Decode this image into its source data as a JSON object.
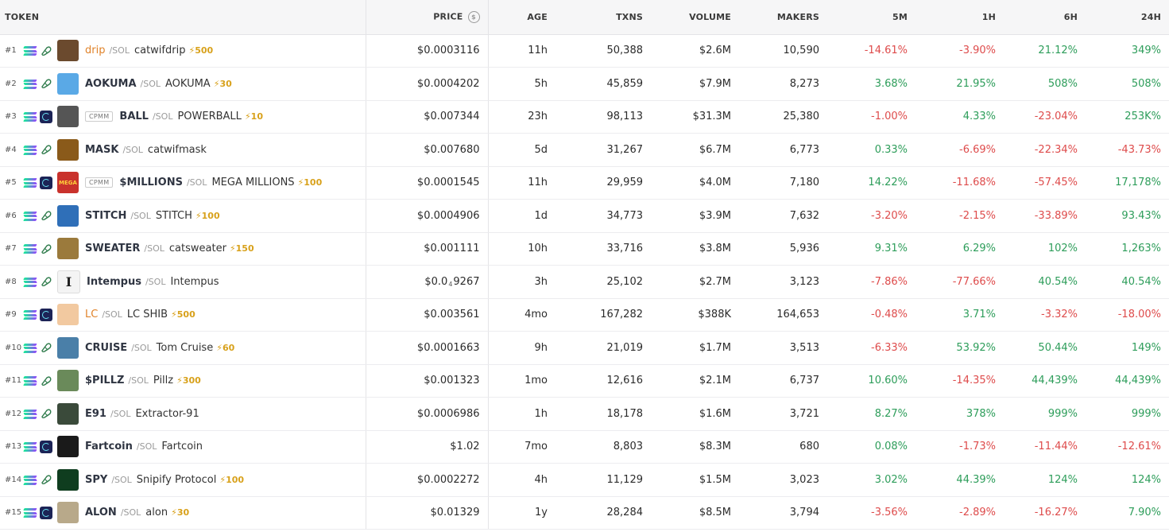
{
  "headers": {
    "token": "TOKEN",
    "price": "PRICE",
    "age": "AGE",
    "txns": "TXNS",
    "volume": "VOLUME",
    "makers": "MAKERS",
    "m5": "5M",
    "h1": "1H",
    "h6": "6H",
    "h24": "24H"
  },
  "rows": [
    {
      "rank": "#1",
      "dex": "pump",
      "badge": "",
      "symbol": "drip",
      "symbol_color": "orange",
      "pair": "/SOL",
      "name": "catwifdrip",
      "boost": "500",
      "avatar_color": "#6b4a2e",
      "avatar_glyph": "",
      "price": "$0.0003116",
      "age": "11h",
      "txns": "50,388",
      "volume": "$2.6M",
      "makers": "10,590",
      "m5": "-14.61%",
      "h1": "-3.90%",
      "h6": "21.12%",
      "h24": "349%"
    },
    {
      "rank": "#2",
      "dex": "pump",
      "badge": "",
      "symbol": "AOKUMA",
      "symbol_color": "",
      "pair": "/SOL",
      "name": "AOKUMA",
      "boost": "30",
      "avatar_color": "#5aa9e6",
      "avatar_glyph": "",
      "price": "$0.0004202",
      "age": "5h",
      "txns": "45,859",
      "volume": "$7.9M",
      "makers": "8,273",
      "m5": "3.68%",
      "h1": "21.95%",
      "h6": "508%",
      "h24": "508%"
    },
    {
      "rank": "#3",
      "dex": "ray",
      "badge": "CPMM",
      "symbol": "BALL",
      "symbol_color": "",
      "pair": "/SOL",
      "name": "POWERBALL",
      "boost": "10",
      "avatar_color": "#555555",
      "avatar_glyph": "",
      "price": "$0.007344",
      "age": "23h",
      "txns": "98,113",
      "volume": "$31.3M",
      "makers": "25,380",
      "m5": "-1.00%",
      "h1": "4.33%",
      "h6": "-23.04%",
      "h24": "253K%"
    },
    {
      "rank": "#4",
      "dex": "pump",
      "badge": "",
      "symbol": "MASK",
      "symbol_color": "",
      "pair": "/SOL",
      "name": "catwifmask",
      "boost": "",
      "avatar_color": "#8a5a1a",
      "avatar_glyph": "",
      "price": "$0.007680",
      "age": "5d",
      "txns": "31,267",
      "volume": "$6.7M",
      "makers": "6,773",
      "m5": "0.33%",
      "h1": "-6.69%",
      "h6": "-22.34%",
      "h24": "-43.73%"
    },
    {
      "rank": "#5",
      "dex": "ray",
      "badge": "CPMM",
      "symbol": "$MILLIONS",
      "symbol_color": "",
      "pair": "/SOL",
      "name": "MEGA MILLIONS",
      "boost": "100",
      "avatar_color": "#c9322c",
      "avatar_glyph": "MEGA",
      "price": "$0.0001545",
      "age": "11h",
      "txns": "29,959",
      "volume": "$4.0M",
      "makers": "7,180",
      "m5": "14.22%",
      "h1": "-11.68%",
      "h6": "-57.45%",
      "h24": "17,178%"
    },
    {
      "rank": "#6",
      "dex": "pump",
      "badge": "",
      "symbol": "STITCH",
      "symbol_color": "",
      "pair": "/SOL",
      "name": "STITCH",
      "boost": "100",
      "avatar_color": "#2f6fb8",
      "avatar_glyph": "",
      "price": "$0.0004906",
      "age": "1d",
      "txns": "34,773",
      "volume": "$3.9M",
      "makers": "7,632",
      "m5": "-3.20%",
      "h1": "-2.15%",
      "h6": "-33.89%",
      "h24": "93.43%"
    },
    {
      "rank": "#7",
      "dex": "pump",
      "badge": "",
      "symbol": "SWEATER",
      "symbol_color": "",
      "pair": "/SOL",
      "name": "catsweater",
      "boost": "150",
      "avatar_color": "#9b7a3c",
      "avatar_glyph": "",
      "price": "$0.001111",
      "age": "10h",
      "txns": "33,716",
      "volume": "$3.8M",
      "makers": "5,936",
      "m5": "9.31%",
      "h1": "6.29%",
      "h6": "102%",
      "h24": "1,263%"
    },
    {
      "rank": "#8",
      "dex": "pump",
      "badge": "",
      "symbol": "Intempus",
      "symbol_color": "",
      "pair": "/SOL",
      "name": "Intempus",
      "boost": "",
      "avatar_color": "#f4f4f4",
      "avatar_glyph": "I",
      "price_pre": "$0.0",
      "price_sub": "4",
      "price_post": "9267",
      "price": "",
      "age": "3h",
      "txns": "25,102",
      "volume": "$2.7M",
      "makers": "3,123",
      "m5": "-7.86%",
      "h1": "-77.66%",
      "h6": "40.54%",
      "h24": "40.54%"
    },
    {
      "rank": "#9",
      "dex": "ray",
      "badge": "",
      "symbol": "LC",
      "symbol_color": "orange",
      "pair": "/SOL",
      "name": "LC SHIB",
      "boost": "500",
      "avatar_color": "#f2c9a0",
      "avatar_glyph": "",
      "price": "$0.003561",
      "age": "4mo",
      "txns": "167,282",
      "volume": "$388K",
      "makers": "164,653",
      "m5": "-0.48%",
      "h1": "3.71%",
      "h6": "-3.32%",
      "h24": "-18.00%"
    },
    {
      "rank": "#10",
      "dex": "pump",
      "badge": "",
      "symbol": "CRUISE",
      "symbol_color": "",
      "pair": "/SOL",
      "name": "Tom Cruise",
      "boost": "60",
      "avatar_color": "#4a7fa8",
      "avatar_glyph": "",
      "price": "$0.0001663",
      "age": "9h",
      "txns": "21,019",
      "volume": "$1.7M",
      "makers": "3,513",
      "m5": "-6.33%",
      "h1": "53.92%",
      "h6": "50.44%",
      "h24": "149%"
    },
    {
      "rank": "#11",
      "dex": "pump",
      "badge": "",
      "symbol": "$PILLZ",
      "symbol_color": "",
      "pair": "/SOL",
      "name": "Pillz",
      "boost": "300",
      "avatar_color": "#6a8a5a",
      "avatar_glyph": "",
      "price": "$0.001323",
      "age": "1mo",
      "txns": "12,616",
      "volume": "$2.1M",
      "makers": "6,737",
      "m5": "10.60%",
      "h1": "-14.35%",
      "h6": "44,439%",
      "h24": "44,439%"
    },
    {
      "rank": "#12",
      "dex": "pump",
      "badge": "",
      "symbol": "E91",
      "symbol_color": "",
      "pair": "/SOL",
      "name": "Extractor-91",
      "boost": "",
      "avatar_color": "#3a4a3a",
      "avatar_glyph": "",
      "price": "$0.0006986",
      "age": "1h",
      "txns": "18,178",
      "volume": "$1.6M",
      "makers": "3,721",
      "m5": "8.27%",
      "h1": "378%",
      "h6": "999%",
      "h24": "999%"
    },
    {
      "rank": "#13",
      "dex": "ray",
      "badge": "",
      "symbol": "Fartcoin",
      "symbol_color": "",
      "pair": "/SOL",
      "name": "Fartcoin",
      "boost": "",
      "avatar_color": "#1a1a1a",
      "avatar_glyph": "",
      "price": "$1.02",
      "age": "7mo",
      "txns": "8,803",
      "volume": "$8.3M",
      "makers": "680",
      "m5": "0.08%",
      "h1": "-1.73%",
      "h6": "-11.44%",
      "h24": "-12.61%"
    },
    {
      "rank": "#14",
      "dex": "pump",
      "badge": "",
      "symbol": "SPY",
      "symbol_color": "",
      "pair": "/SOL",
      "name": "Snipify Protocol",
      "boost": "100",
      "avatar_color": "#0f3d1f",
      "avatar_glyph": "",
      "price": "$0.0002272",
      "age": "4h",
      "txns": "11,129",
      "volume": "$1.5M",
      "makers": "3,023",
      "m5": "3.02%",
      "h1": "44.39%",
      "h6": "124%",
      "h24": "124%"
    },
    {
      "rank": "#15",
      "dex": "ray",
      "badge": "",
      "symbol": "ALON",
      "symbol_color": "",
      "pair": "/SOL",
      "name": "alon",
      "boost": "30",
      "avatar_color": "#b8a98a",
      "avatar_glyph": "",
      "price": "$0.01329",
      "age": "1y",
      "txns": "28,284",
      "volume": "$8.5M",
      "makers": "3,794",
      "m5": "-3.56%",
      "h1": "-2.89%",
      "h6": "-16.27%",
      "h24": "7.90%"
    }
  ]
}
